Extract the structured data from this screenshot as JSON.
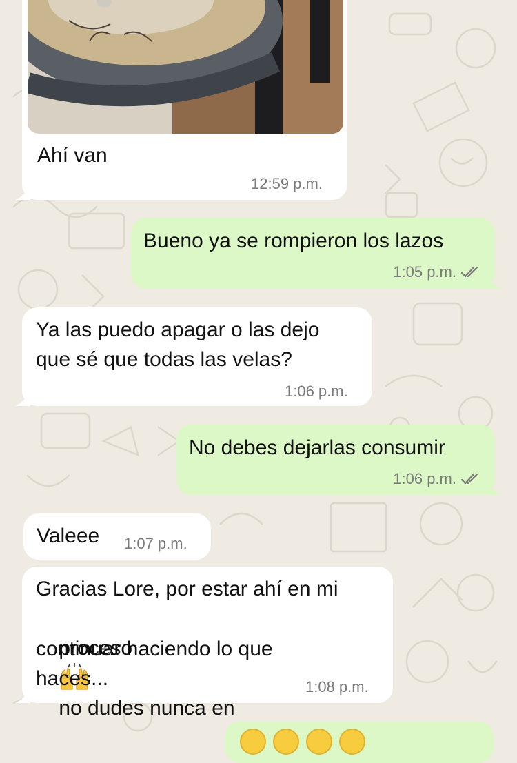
{
  "chat": {
    "messages": [
      {
        "id": "m1",
        "direction": "incoming",
        "type": "image",
        "caption": "Ahí van",
        "time": "12:59 p.m."
      },
      {
        "id": "m2",
        "direction": "outgoing",
        "text": "Bueno ya se rompieron los lazos",
        "time": "1:05 p.m.",
        "status": "read"
      },
      {
        "id": "m3",
        "direction": "incoming",
        "lines": [
          "Ya las puedo apagar o las dejo",
          "que sé que todas las velas?"
        ],
        "time": "1:06 p.m."
      },
      {
        "id": "m4",
        "direction": "outgoing",
        "text": "No debes dejarlas consumir",
        "time": "1:06 p.m.",
        "status": "read"
      },
      {
        "id": "m5",
        "direction": "incoming",
        "text": "Valeee",
        "time": "1:07 p.m."
      },
      {
        "id": "m6",
        "direction": "incoming",
        "line1": "Gracias Lore, por estar ahí en mi",
        "line2_before": "proceso",
        "line2_emoji": "raising-hands-emoji",
        "line2_after": "no dudes nunca en",
        "line3": "continuar haciendo lo que",
        "line4": "haces...",
        "time": "1:08 p.m."
      },
      {
        "id": "m7",
        "direction": "outgoing",
        "type": "emoji",
        "emojis": [
          "smiling-face-emoji",
          "smiling-face-emoji",
          "smiling-face-emoji",
          "smiling-face-emoji"
        ]
      }
    ]
  },
  "colors": {
    "incoming": "#ffffff",
    "outgoing": "#dcf8c6",
    "background": "#efeae2",
    "meta": "#7b7b7b",
    "read_ticks": "#7b7b7b"
  },
  "icons": {
    "read_status": "double-check-icon"
  }
}
